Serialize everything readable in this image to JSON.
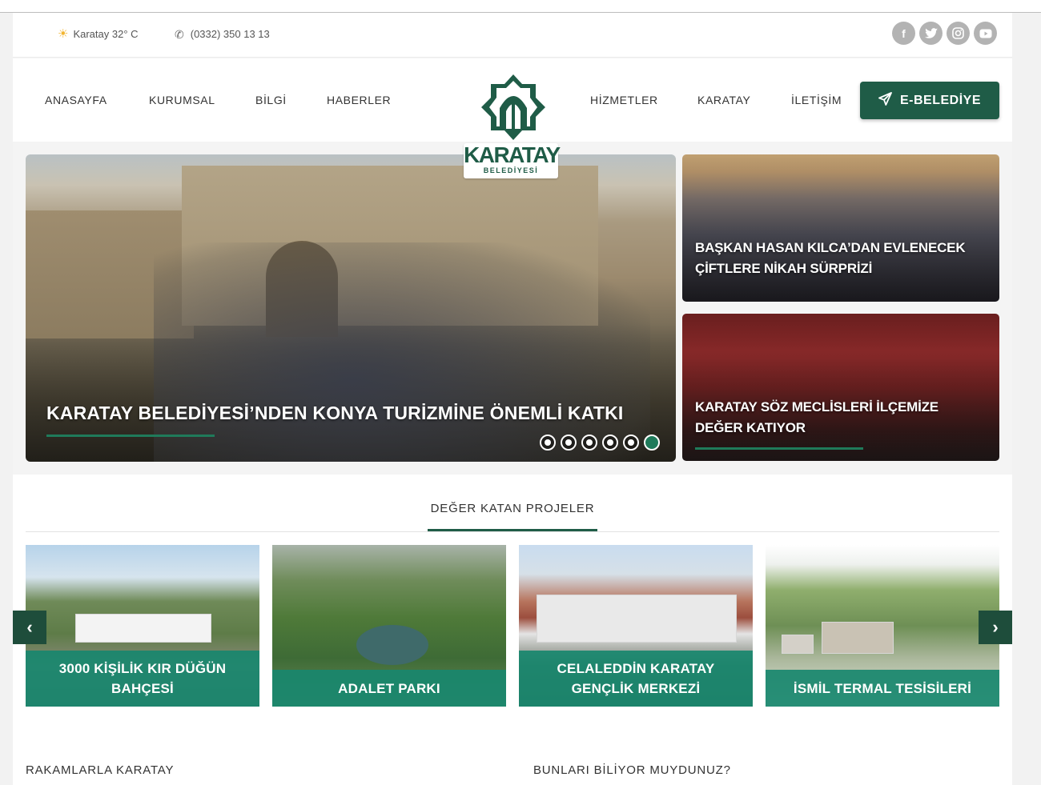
{
  "infobar": {
    "weather": "Karatay 32° C",
    "phone": "(0332) 350 13 13",
    "socials": [
      "facebook",
      "twitter",
      "instagram",
      "youtube"
    ]
  },
  "nav": {
    "left": [
      "ANASAYFA",
      "KURUMSAL",
      "BİLGİ",
      "HABERLER"
    ],
    "right": [
      "HİZMETLER",
      "KARATAY",
      "İLETİŞİM"
    ],
    "ebelediye": "E-BELEDİYE"
  },
  "logo": {
    "word": "KARATAY",
    "sub": "BELEDİYESİ"
  },
  "hero": {
    "main_title": "KARATAY BELEDİYESİ’NDEN KONYA TURİZMİNE ÖNEMLİ KATKI",
    "slides_total": 6,
    "active_slide": 6,
    "side": [
      {
        "title_line1": "BAŞKAN HASAN KILCA’DAN EVLENECEK",
        "title_line2": "ÇİFTLERE NİKAH SÜRPRİZİ"
      },
      {
        "title_line1": "KARATAY SÖZ MECLİSLERİ İLÇEMİZE",
        "title_line2": "DEĞER KATIYOR"
      }
    ]
  },
  "projects": {
    "title": "DEĞER KATAN PROJELER",
    "items": [
      {
        "line1": "3000 KİŞİLİK KIR DÜĞÜN",
        "line2": "BAHÇESİ"
      },
      {
        "line1": "ADALET PARKI",
        "line2": ""
      },
      {
        "line1": "CELALEDDİN KARATAY",
        "line2": "GENÇLİK MERKEZİ"
      },
      {
        "line1": "İSMİL TERMAL TESİSİLERİ",
        "line2": ""
      }
    ],
    "prev_icon": "‹",
    "next_icon": "›"
  },
  "bottom": {
    "left_title": "RAKAMLARLA KARATAY",
    "right_title": "BUNLARI BİLİYOR MUYDUNUZ?"
  },
  "colors": {
    "brand": "#1f5c47",
    "accent": "#18876e"
  }
}
